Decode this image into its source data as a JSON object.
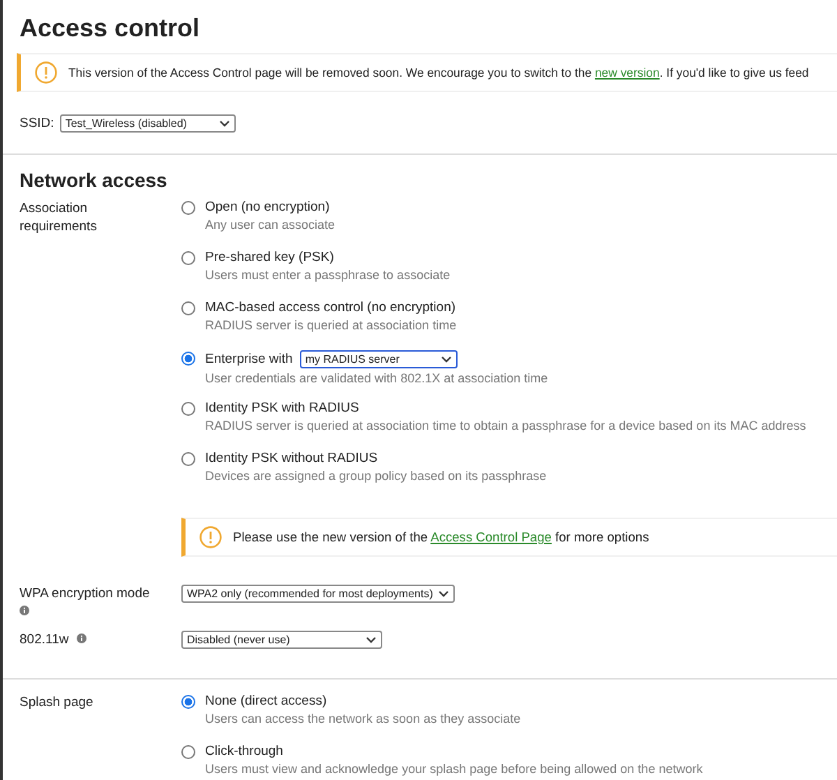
{
  "title": "Access control",
  "banner": {
    "before": "This version of the Access Control page will be removed soon. We encourage you to switch to the ",
    "link": "new version",
    "after": ". If you'd like to give us feed"
  },
  "ssid": {
    "label": "SSID:",
    "value": "Test_Wireless (disabled)"
  },
  "network_access": {
    "heading": "Network access",
    "association": {
      "label": "Association requirements",
      "options": [
        {
          "label": "Open (no encryption)",
          "description": "Any user can associate",
          "selected": false
        },
        {
          "label": "Pre-shared key (PSK)",
          "description": "Users must enter a passphrase to associate",
          "selected": false
        },
        {
          "label": "MAC-based access control (no encryption)",
          "description": "RADIUS server is queried at association time",
          "selected": false
        },
        {
          "label": "Enterprise with",
          "select": "my RADIUS server",
          "description": "User credentials are validated with 802.1X at association time",
          "selected": true
        },
        {
          "label": "Identity PSK with RADIUS",
          "description": "RADIUS server is queried at association time to obtain a passphrase for a device based on its MAC address",
          "selected": false
        },
        {
          "label": "Identity PSK without RADIUS",
          "description": "Devices are assigned a group policy based on its passphrase",
          "selected": false
        }
      ],
      "notice": {
        "before": "Please use the new version of the ",
        "link": "Access Control Page",
        "after": " for more options"
      }
    },
    "wpa": {
      "label": "WPA encryption mode",
      "value": "WPA2 only (recommended for most deployments)"
    },
    "w80211": {
      "label": "802.11w",
      "value": "Disabled (never use)"
    }
  },
  "splash": {
    "label": "Splash page",
    "options": [
      {
        "label": "None (direct access)",
        "description": "Users can access the network as soon as they associate",
        "selected": true
      },
      {
        "label": "Click-through",
        "description": "Users must view and acknowledge your splash page before being allowed on the network",
        "selected": false
      }
    ]
  }
}
